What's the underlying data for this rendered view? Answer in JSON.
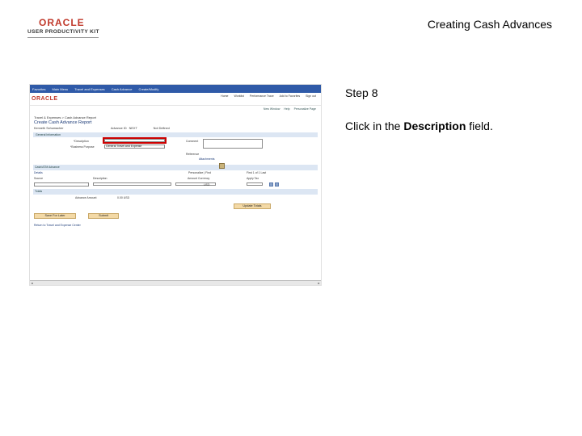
{
  "header": {
    "logo_top": "ORACLE",
    "logo_bottom": "USER PRODUCTIVITY KIT",
    "doc_title": "Creating Cash Advances"
  },
  "step": {
    "label": "Step 8",
    "instruction_prefix": "Click in the ",
    "instruction_bold": "Description",
    "instruction_suffix": " field."
  },
  "screenshot": {
    "nav_items": [
      "Favorites",
      "Main Menu",
      "Travel and Expenses",
      "Cash Advance",
      "Create/Modify"
    ],
    "brand": "ORACLE",
    "header_links": [
      "Home",
      "Worklist",
      "Performance Trace",
      "Add to Favorites",
      "Sign out"
    ],
    "top_links": [
      "New Window",
      "Help",
      "Personalize Page"
    ],
    "breadcrumb": "Travel & Expenses > Cash Advance Report",
    "page_title": "Create Cash Advance Report",
    "employee_name": "Kenneth Schumacher",
    "advance_id_label": "Advance ID",
    "advance_id_value": "NEXT",
    "status": "Not Defined",
    "general_info": "General Information",
    "description_label": "*Description",
    "business_purpose_label": "*Business Purpose",
    "business_purpose_value": "General Travel and Expense",
    "comment_label": "Comment",
    "reference_label": "Reference",
    "attachments": "Attachments",
    "cash_advance_label": "Cash/ATM Advance",
    "details_label": "Details",
    "personalize": "Personalize | Find",
    "range": "First 1 of 1 Last",
    "col_source": "Source",
    "col_description": "Description",
    "col_amount_currency": "Amount Currency",
    "col_apply_tax": "Apply Tax",
    "currency_value": "USD",
    "totals_label": "Totals",
    "advance_amount_label": "Advance Amount",
    "advance_amount_value": "0.00 USD",
    "update_totals": "Update Totals",
    "save_for_later": "Save For Later",
    "submit": "Submit",
    "return_link": "Return to Travel and Expense Center"
  }
}
